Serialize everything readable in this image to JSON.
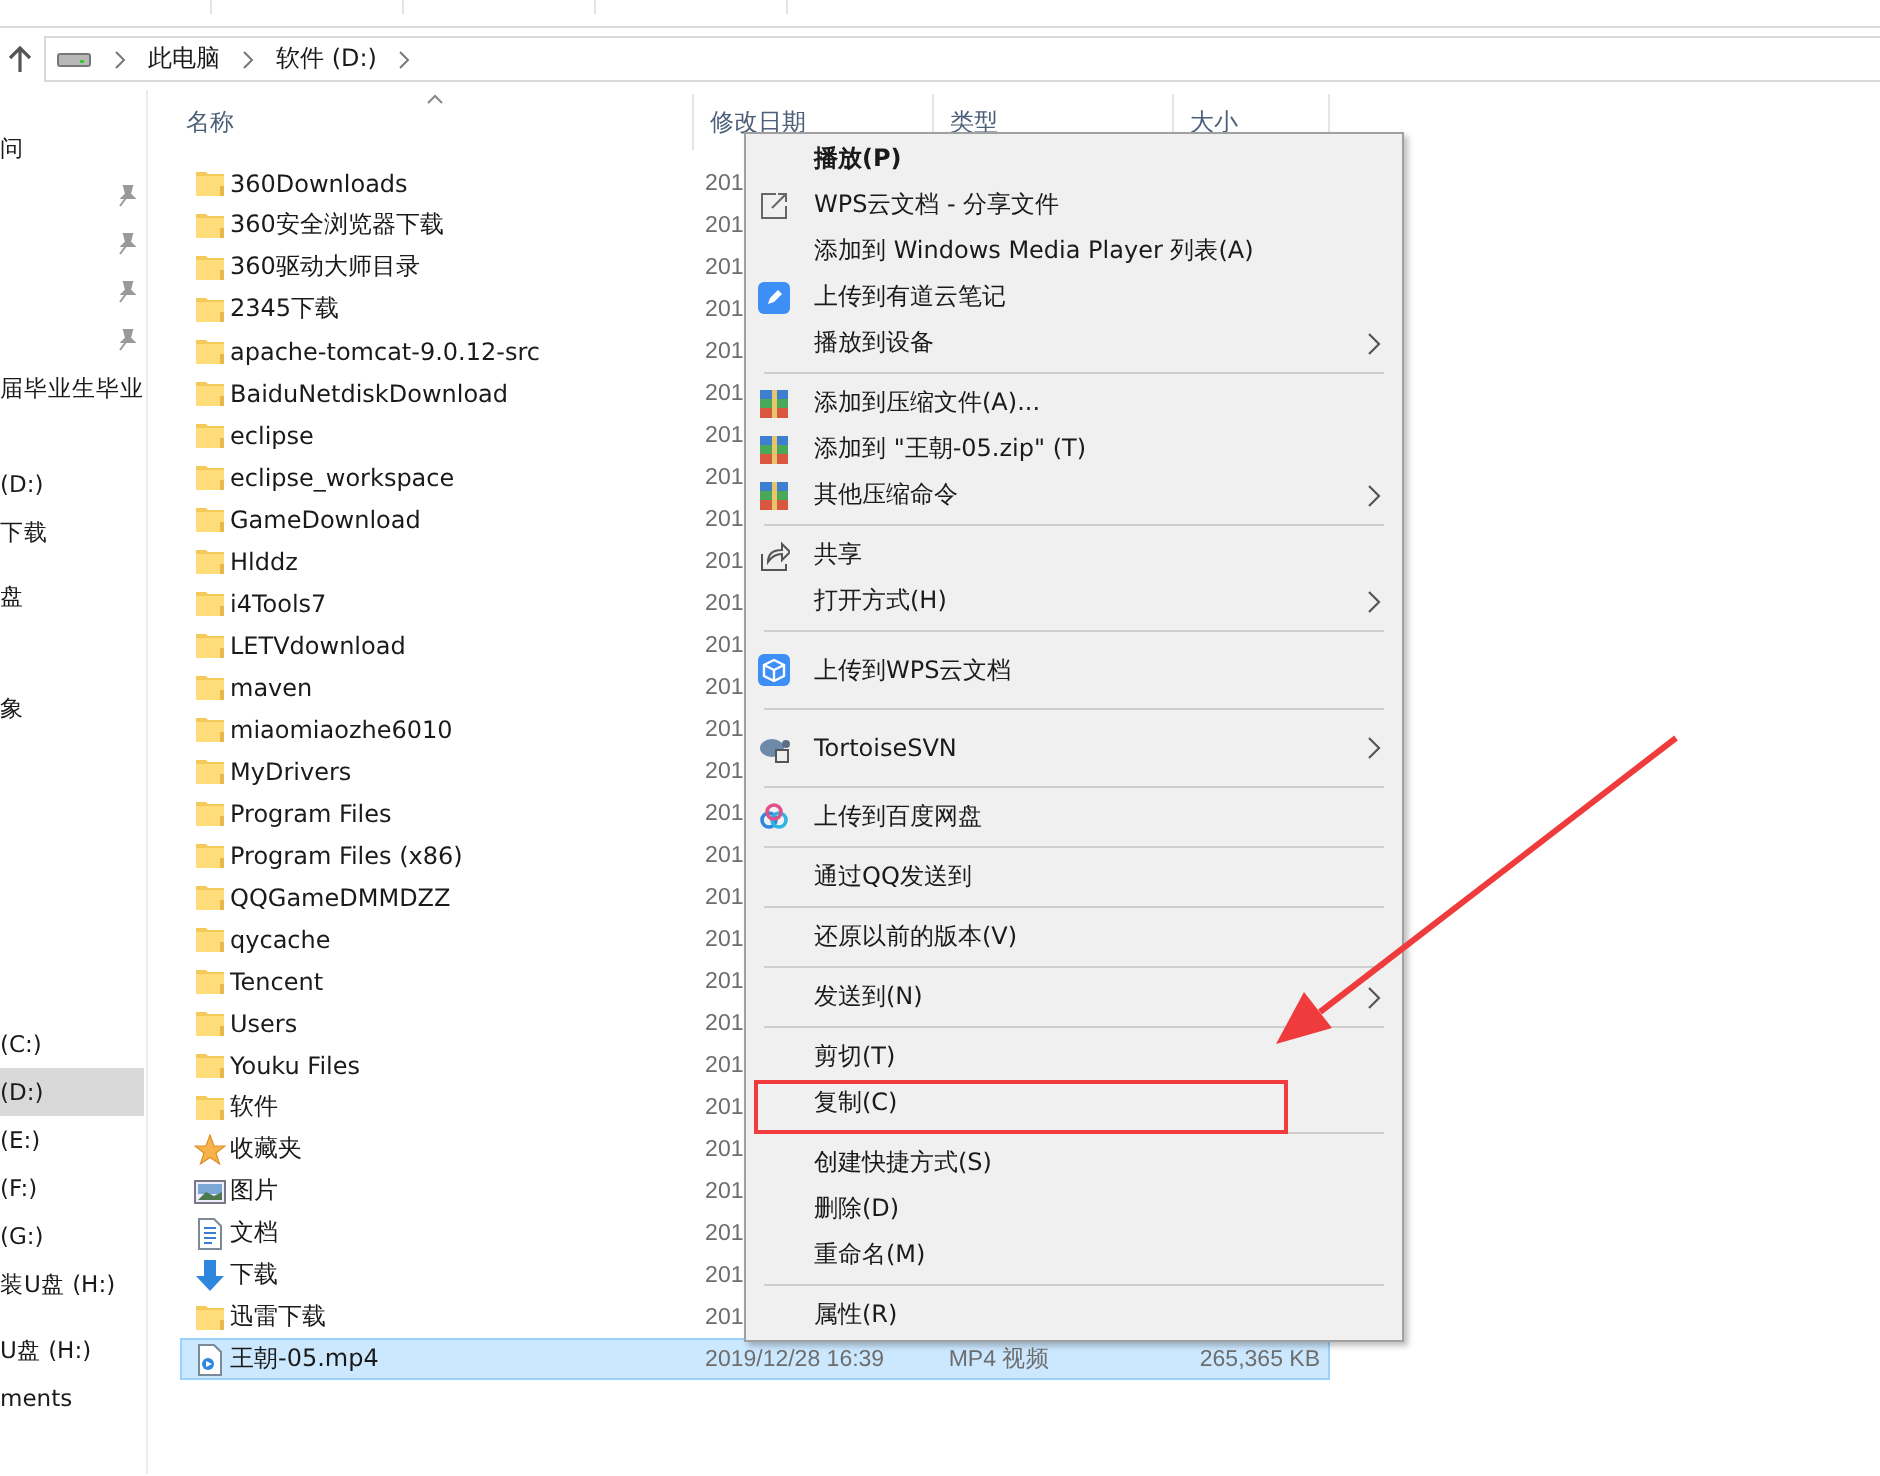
{
  "address": {
    "crumbs": [
      "此电脑",
      "软件 (D:)"
    ]
  },
  "nav": {
    "sections": [
      {
        "items": [
          {
            "label": "问",
            "pinned": false,
            "selected": false
          },
          {
            "pinned": true,
            "selected": false
          },
          {
            "pinned": true,
            "selected": false
          },
          {
            "pinned": true,
            "selected": false
          },
          {
            "pinned": true,
            "selected": false
          },
          {
            "label": "届毕业生毕业",
            "pinned": false,
            "selected": false
          }
        ]
      },
      {
        "items": [
          {
            "label": "(D:)",
            "pinned": false,
            "selected": false
          },
          {
            "label": "下载",
            "pinned": false,
            "selected": false
          }
        ]
      },
      {
        "items": [
          {
            "label": "盘",
            "pinned": false,
            "selected": false
          }
        ]
      },
      {
        "items": [
          {
            "label": "象",
            "pinned": false,
            "selected": false
          }
        ]
      },
      {
        "items": [
          {
            "label": "(C:)",
            "pinned": false,
            "selected": false
          },
          {
            "label": "(D:)",
            "pinned": false,
            "selected": true
          },
          {
            "label": "(E:)",
            "pinned": false,
            "selected": false
          },
          {
            "label": "(F:)",
            "pinned": false,
            "selected": false
          },
          {
            "label": "(G:)",
            "pinned": false,
            "selected": false
          },
          {
            "label": "装U盘 (H:)",
            "pinned": false,
            "selected": false
          }
        ]
      },
      {
        "items": [
          {
            "label": "U盘 (H:)",
            "pinned": false,
            "selected": false
          },
          {
            "label": "ments",
            "pinned": false,
            "selected": false
          }
        ]
      }
    ]
  },
  "columns": [
    {
      "label": "名称",
      "sorted": true
    },
    {
      "label": "修改日期",
      "sorted": false
    },
    {
      "label": "类型",
      "sorted": false
    },
    {
      "label": "大小",
      "sorted": false
    }
  ],
  "files": [
    {
      "kind": "folder",
      "name": "360Downloads",
      "date": "201",
      "selected": false
    },
    {
      "kind": "folder",
      "name": "360安全浏览器下载",
      "date": "201",
      "selected": false
    },
    {
      "kind": "folder",
      "name": "360驱动大师目录",
      "date": "201",
      "selected": false
    },
    {
      "kind": "folder",
      "name": "2345下载",
      "date": "201",
      "selected": false
    },
    {
      "kind": "folder",
      "name": "apache-tomcat-9.0.12-src",
      "date": "201",
      "selected": false
    },
    {
      "kind": "folder",
      "name": "BaiduNetdiskDownload",
      "date": "201",
      "selected": false
    },
    {
      "kind": "folder",
      "name": "eclipse",
      "date": "201",
      "selected": false
    },
    {
      "kind": "folder",
      "name": "eclipse_workspace",
      "date": "201",
      "selected": false
    },
    {
      "kind": "folder",
      "name": "GameDownload",
      "date": "201",
      "selected": false
    },
    {
      "kind": "folder",
      "name": "Hlddz",
      "date": "201",
      "selected": false
    },
    {
      "kind": "folder",
      "name": "i4Tools7",
      "date": "201",
      "selected": false
    },
    {
      "kind": "folder",
      "name": "LETVdownload",
      "date": "201",
      "selected": false
    },
    {
      "kind": "folder",
      "name": "maven",
      "date": "201",
      "selected": false
    },
    {
      "kind": "folder",
      "name": "miaomiaozhe6010",
      "date": "201",
      "selected": false
    },
    {
      "kind": "folder",
      "name": "MyDrivers",
      "date": "201",
      "selected": false
    },
    {
      "kind": "folder",
      "name": "Program Files",
      "date": "201",
      "selected": false
    },
    {
      "kind": "folder",
      "name": "Program Files (x86)",
      "date": "201",
      "selected": false
    },
    {
      "kind": "folder",
      "name": "QQGameDMMDZZ",
      "date": "201",
      "selected": false
    },
    {
      "kind": "folder",
      "name": "qycache",
      "date": "201",
      "selected": false
    },
    {
      "kind": "folder",
      "name": "Tencent",
      "date": "201",
      "selected": false
    },
    {
      "kind": "folder",
      "name": "Users",
      "date": "201",
      "selected": false
    },
    {
      "kind": "folder",
      "name": "Youku Files",
      "date": "201",
      "selected": false
    },
    {
      "kind": "folder",
      "name": "软件",
      "date": "201",
      "selected": false
    },
    {
      "kind": "favorites",
      "name": "收藏夹",
      "date": "201",
      "selected": false
    },
    {
      "kind": "pictures",
      "name": "图片",
      "date": "201",
      "selected": false
    },
    {
      "kind": "documents",
      "name": "文档",
      "date": "201",
      "selected": false
    },
    {
      "kind": "downloads",
      "name": "下载",
      "date": "201",
      "selected": false
    },
    {
      "kind": "folder",
      "name": "迅雷下载",
      "date": "201",
      "selected": false
    },
    {
      "kind": "video",
      "name": "王朝-05.mp4",
      "date": "2019/12/28 16:39",
      "type": "MP4 视频",
      "size": "265,365 KB",
      "selected": true
    }
  ],
  "context_menu": {
    "items": [
      {
        "kind": "plain",
        "label": "播放(P)",
        "bold": true,
        "submenu": false,
        "marked": false
      },
      {
        "kind": "share-box",
        "label": "WPS云文档 - 分享文件",
        "bold": false,
        "submenu": false,
        "marked": false
      },
      {
        "kind": "plain",
        "label": "添加到 Windows Media Player 列表(A)",
        "bold": false,
        "submenu": false,
        "marked": false
      },
      {
        "kind": "note",
        "label": "上传到有道云笔记",
        "bold": false,
        "submenu": false,
        "marked": false
      },
      {
        "kind": "plain",
        "label": "播放到设备",
        "bold": false,
        "submenu": true,
        "marked": false
      },
      {
        "kind": "separator"
      },
      {
        "kind": "archive",
        "label": "添加到压缩文件(A)...",
        "bold": false,
        "submenu": false,
        "marked": false
      },
      {
        "kind": "archive",
        "label": "添加到 \"王朝-05.zip\" (T)",
        "bold": false,
        "submenu": false,
        "marked": false
      },
      {
        "kind": "archive",
        "label": "其他压缩命令",
        "bold": false,
        "submenu": true,
        "marked": false
      },
      {
        "kind": "separator"
      },
      {
        "kind": "share",
        "label": "共享",
        "bold": false,
        "submenu": false,
        "marked": false
      },
      {
        "kind": "plain",
        "label": "打开方式(H)",
        "bold": false,
        "submenu": true,
        "marked": false
      },
      {
        "kind": "separator"
      },
      {
        "kind": "cube",
        "label": "上传到WPS云文档",
        "bold": false,
        "submenu": false,
        "marked": false
      },
      {
        "kind": "separator"
      },
      {
        "kind": "turtle",
        "label": "TortoiseSVN",
        "bold": false,
        "submenu": true,
        "marked": false
      },
      {
        "kind": "separator"
      },
      {
        "kind": "cloud",
        "label": "上传到百度网盘",
        "bold": false,
        "submenu": false,
        "marked": false
      },
      {
        "kind": "separator"
      },
      {
        "kind": "plain",
        "label": "通过QQ发送到",
        "bold": false,
        "submenu": false,
        "marked": false
      },
      {
        "kind": "separator"
      },
      {
        "kind": "plain",
        "label": "还原以前的版本(V)",
        "bold": false,
        "submenu": false,
        "marked": false
      },
      {
        "kind": "separator"
      },
      {
        "kind": "plain",
        "label": "发送到(N)",
        "bold": false,
        "submenu": true,
        "marked": false
      },
      {
        "kind": "separator"
      },
      {
        "kind": "plain",
        "label": "剪切(T)",
        "bold": false,
        "submenu": false,
        "marked": false
      },
      {
        "kind": "plain",
        "label": "复制(C)",
        "bold": false,
        "submenu": false,
        "marked": true
      },
      {
        "kind": "separator"
      },
      {
        "kind": "plain",
        "label": "创建快捷方式(S)",
        "bold": false,
        "submenu": false,
        "marked": false
      },
      {
        "kind": "plain",
        "label": "删除(D)",
        "bold": false,
        "submenu": false,
        "marked": false
      },
      {
        "kind": "plain",
        "label": "重命名(M)",
        "bold": false,
        "submenu": false,
        "marked": false
      },
      {
        "kind": "separator"
      },
      {
        "kind": "plain",
        "label": "属性(R)",
        "bold": false,
        "submenu": false,
        "marked": false
      }
    ]
  }
}
